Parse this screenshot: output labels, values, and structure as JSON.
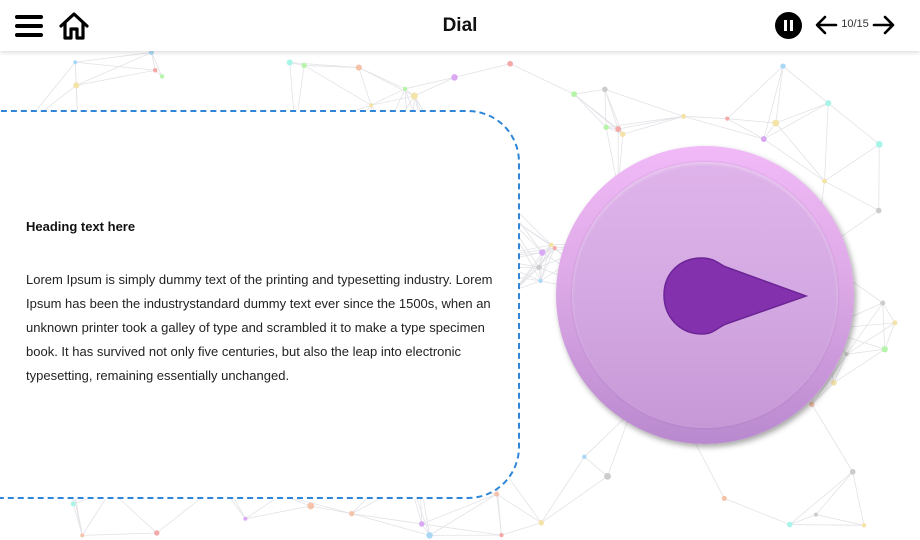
{
  "header": {
    "title": "Dial",
    "page_counter": "10/15",
    "icons": {
      "menu": "hamburger-menu-icon",
      "home": "home-icon",
      "pause": "pause-icon",
      "prev": "arrow-left-icon",
      "next": "arrow-right-icon"
    }
  },
  "content": {
    "heading": "Heading text here",
    "body": "Lorem Ipsum is simply dummy text of the printing and typesetting industry. Lorem Ipsum has been the industrystandard dummy text ever since the 1500s, when an unknown printer took a galley of type and scrambled it to make a type specimen book. It has survived not only five centuries, but also the leap into electronic typesetting, remaining essentially unchanged."
  },
  "dial": {
    "pointer_direction": "right",
    "colors": {
      "dial_light": "#f1b9f7",
      "dial_dark": "#b989cf",
      "pointer": "#8331ad",
      "card_border": "#2f86d8"
    }
  }
}
